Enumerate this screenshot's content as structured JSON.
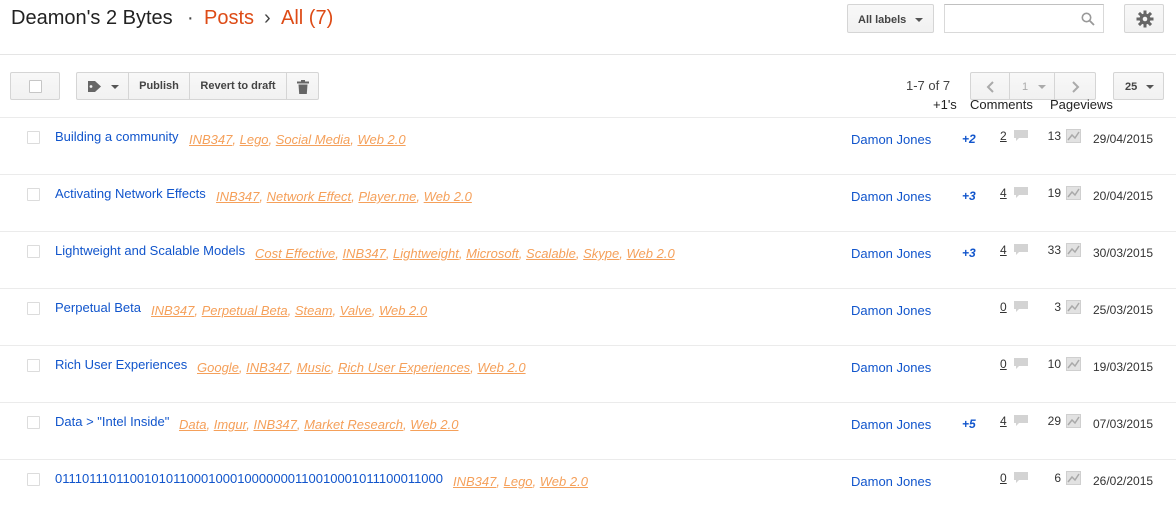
{
  "header": {
    "blog_title": "Deamon's 2 Bytes",
    "sep1": "·",
    "crumb_posts": "Posts",
    "sep2": "›",
    "crumb_all": "All (7)",
    "labels_dropdown": "All labels",
    "search_placeholder": ""
  },
  "toolbar": {
    "publish_label": "Publish",
    "revert_label": "Revert to draft",
    "page_range": "1-7 of 7",
    "page_number": "1",
    "per_page": "25"
  },
  "columns": {
    "plus_ones": "+1's",
    "comments": "Comments",
    "pageviews": "Pageviews"
  },
  "posts": [
    {
      "title": "Building a community",
      "labels": [
        "INB347",
        "Lego",
        "Social Media",
        "Web 2.0"
      ],
      "author": "Damon Jones",
      "plus_ones": "+2",
      "comments": "2",
      "pageviews": "13",
      "date": "29/04/2015"
    },
    {
      "title": "Activating Network Effects",
      "labels": [
        "INB347",
        "Network Effect",
        "Player.me",
        "Web 2.0"
      ],
      "author": "Damon Jones",
      "plus_ones": "+3",
      "comments": "4",
      "pageviews": "19",
      "date": "20/04/2015"
    },
    {
      "title": "Lightweight and Scalable Models",
      "labels": [
        "Cost Effective",
        "INB347",
        "Lightweight",
        "Microsoft",
        "Scalable",
        "Skype",
        "Web 2.0"
      ],
      "author": "Damon Jones",
      "plus_ones": "+3",
      "comments": "4",
      "pageviews": "33",
      "date": "30/03/2015"
    },
    {
      "title": "Perpetual Beta",
      "labels": [
        "INB347",
        "Perpetual Beta",
        "Steam",
        "Valve",
        "Web 2.0"
      ],
      "author": "Damon Jones",
      "plus_ones": "",
      "comments": "0",
      "pageviews": "3",
      "date": "25/03/2015"
    },
    {
      "title": "Rich User Experiences",
      "labels": [
        "Google",
        "INB347",
        "Music",
        "Rich User Experiences",
        "Web 2.0"
      ],
      "author": "Damon Jones",
      "plus_ones": "",
      "comments": "0",
      "pageviews": "10",
      "date": "19/03/2015"
    },
    {
      "title": "Data > \"Intel Inside\"",
      "labels": [
        "Data",
        "Imgur",
        "INB347",
        "Market Research",
        "Web 2.0"
      ],
      "author": "Damon Jones",
      "plus_ones": "+5",
      "comments": "4",
      "pageviews": "29",
      "date": "07/03/2015"
    },
    {
      "title": "0111011101100101011000100010000000110010001011100011000",
      "labels": [
        "INB347",
        "Lego",
        "Web 2.0"
      ],
      "author": "Damon Jones",
      "plus_ones": "",
      "comments": "0",
      "pageviews": "6",
      "date": "26/02/2015"
    }
  ],
  "icons": {
    "label": "tag-icon",
    "trash": "trash-icon",
    "prev": "chevron-left-icon",
    "next": "chevron-right-icon",
    "search": "search-icon",
    "settings": "gear-icon",
    "comment": "comment-icon",
    "pageviews": "chart-icon"
  },
  "colors": {
    "breadcrumb": "#dd4b16",
    "link": "#1155cc",
    "label": "#f5a05a"
  }
}
